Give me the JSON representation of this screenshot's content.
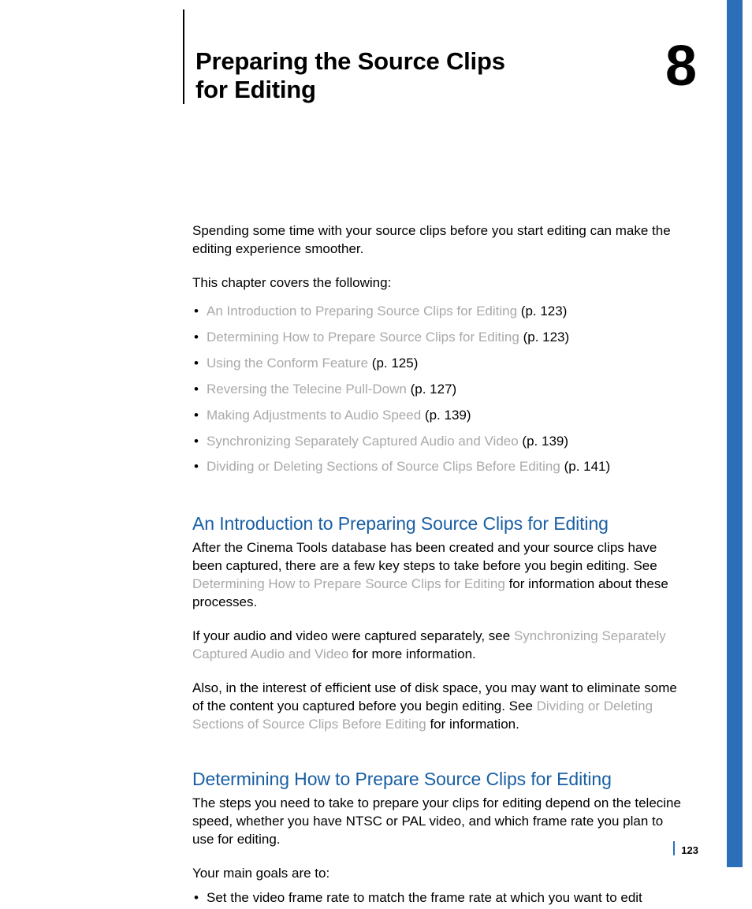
{
  "header": {
    "title": "Preparing the Source Clips for Editing",
    "chapter_number": "8"
  },
  "intro": {
    "para": "Spending some time with your source clips before you start editing can make the editing experience smoother.",
    "covers": "This chapter covers the following:"
  },
  "toc": [
    {
      "label": "An Introduction to Preparing Source Clips for Editing",
      "page": "(p. 123)"
    },
    {
      "label": "Determining How to Prepare Source Clips for Editing",
      "page": "(p. 123)"
    },
    {
      "label": "Using the Conform Feature",
      "page": "(p. 125)"
    },
    {
      "label": "Reversing the Telecine Pull-Down",
      "page": "(p. 127)"
    },
    {
      "label": "Making Adjustments to Audio Speed",
      "page": "(p. 139)"
    },
    {
      "label": "Synchronizing Separately Captured Audio and Video",
      "page": "(p. 139)"
    },
    {
      "label": "Dividing or Deleting Sections of Source Clips Before Editing",
      "page": "(p. 141)"
    }
  ],
  "section1": {
    "heading": "An Introduction to Preparing Source Clips for Editing",
    "p1a": "After the Cinema Tools database has been created and your source clips have been captured, there are a few key steps to take before you begin editing. See ",
    "p1link": "Determining How to Prepare Source Clips for Editing",
    "p1b": " for information about these processes.",
    "p2a": "If your audio and video were captured separately, see ",
    "p2link": "Synchronizing Separately Captured Audio and Video",
    "p2b": " for more information.",
    "p3a": "Also, in the interest of efficient use of disk space, you may want to eliminate some of the content you captured before you begin editing. See ",
    "p3link": "Dividing or Deleting Sections of Source Clips Before Editing",
    "p3b": " for information."
  },
  "section2": {
    "heading": "Determining How to Prepare Source Clips for Editing",
    "p1": "The steps you need to take to prepare your clips for editing depend on the telecine speed, whether you have NTSC or PAL video, and which frame rate you plan to use for editing.",
    "goals_intro": "Your main goals are to:",
    "goal1": "Set the video frame rate to match the frame rate at which you want to edit"
  },
  "footer": {
    "page_number": "123"
  }
}
